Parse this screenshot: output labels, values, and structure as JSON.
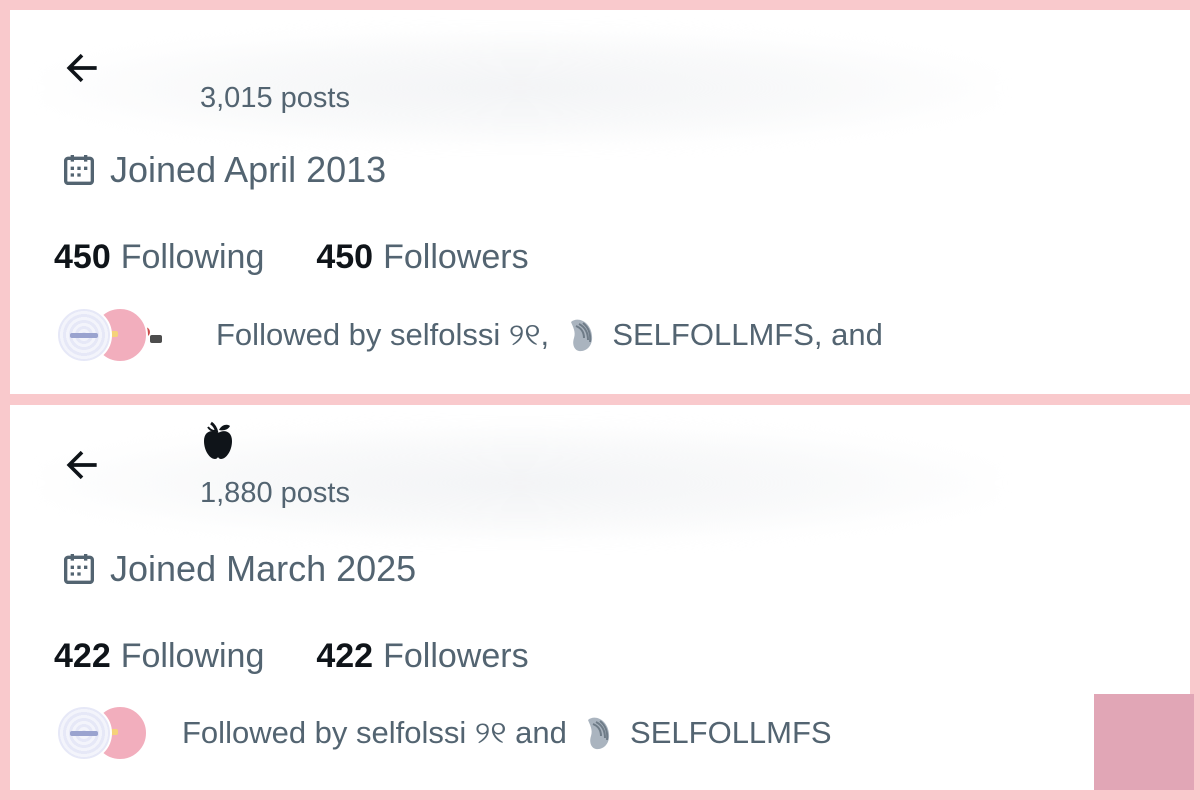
{
  "profiles": [
    {
      "post_count": "3,015 posts",
      "joined": "Joined April 2013",
      "following_count": "450",
      "following_label": "Following",
      "followers_count": "450",
      "followers_label": "Followers",
      "followed_by_prefix": "Followed by selfolssi ୨୧, ",
      "followed_by_suffix": " SELFOLLMFS, and"
    },
    {
      "post_count": "1,880 posts",
      "joined": "Joined March 2025",
      "following_count": "422",
      "following_label": "Following",
      "followers_count": "422",
      "followers_label": "Followers",
      "followed_by_prefix": "Followed by selfolssi ୨୧ and ",
      "followed_by_suffix": " SELFOLLMFS"
    }
  ],
  "icons": {
    "back": "arrow-left-icon",
    "calendar": "calendar-icon",
    "shell": "shell-emoji-icon",
    "display_name_emoji": "apple-emoji-icon"
  },
  "colors": {
    "background": "#f9c9cc",
    "panel": "#ffffff",
    "primary_text": "#0f1419",
    "secondary_text": "#536471",
    "accent_square": "#e1a6b6"
  }
}
